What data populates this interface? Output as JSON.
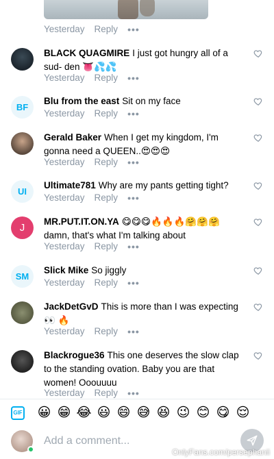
{
  "post": {
    "time": "Yesterday",
    "reply_label": "Reply",
    "more_label": "•••"
  },
  "comments": [
    {
      "name": "BLACK QUAGMIRE",
      "text": "I just got hungry all of a sud- den 👅💦💦",
      "time": "Yesterday",
      "reply_label": "Reply",
      "more_label": "•••",
      "avatar": "photo"
    },
    {
      "name": "Blu from the east",
      "text": "Sit on my face",
      "time": "Yesterday",
      "reply_label": "Reply",
      "more_label": "•••",
      "avatar_initials": "BF"
    },
    {
      "name": "Gerald Baker",
      "text": "When I get my kingdom, I'm gonna need a QUEEN..😍😍😍",
      "time": "Yesterday",
      "reply_label": "Reply",
      "more_label": "•••",
      "avatar": "photo"
    },
    {
      "name": "Ultimate781",
      "text": "Why are my pants getting tight?",
      "time": "Yesterday",
      "reply_label": "Reply",
      "more_label": "•••",
      "avatar_initials": "UI"
    },
    {
      "name": "MR.PUT.IT.ON.YA",
      "text": "😋😋😋🔥🔥🔥🤗🤗🤗 damn, that's what I'm talking about",
      "time": "Yesterday",
      "reply_label": "Reply",
      "more_label": "•••",
      "avatar_initials": "J"
    },
    {
      "name": "Slick Mike",
      "text": "So jiggly",
      "time": "Yesterday",
      "reply_label": "Reply",
      "more_label": "•••",
      "avatar_initials": "SM"
    },
    {
      "name": "JackDetGvD",
      "text": "This is more than I was expecting 👀 🔥",
      "time": "Yesterday",
      "reply_label": "Reply",
      "more_label": "•••",
      "avatar": "photo"
    },
    {
      "name": "Blackrogue36",
      "text": "This one deserves the slow clap to the standing ovation. Baby you are that women! Ooouuuu",
      "time": "Yesterday",
      "reply_label": "Reply",
      "more_label": "•••",
      "avatar": "photo"
    }
  ],
  "emoji_bar": {
    "gif_label": "GIF",
    "emojis": [
      "😀",
      "😁",
      "😂",
      "😃",
      "😄",
      "😅",
      "😆",
      "😉",
      "😊",
      "😋",
      "😌"
    ]
  },
  "composer": {
    "placeholder": "Add a comment..."
  },
  "watermark": "OnlyFans.com/persephanii",
  "colors": {
    "accent": "#00aff0",
    "meta_gray": "#8a96a3",
    "online": "#25c26a",
    "pink_avatar": "#e33e6e"
  }
}
